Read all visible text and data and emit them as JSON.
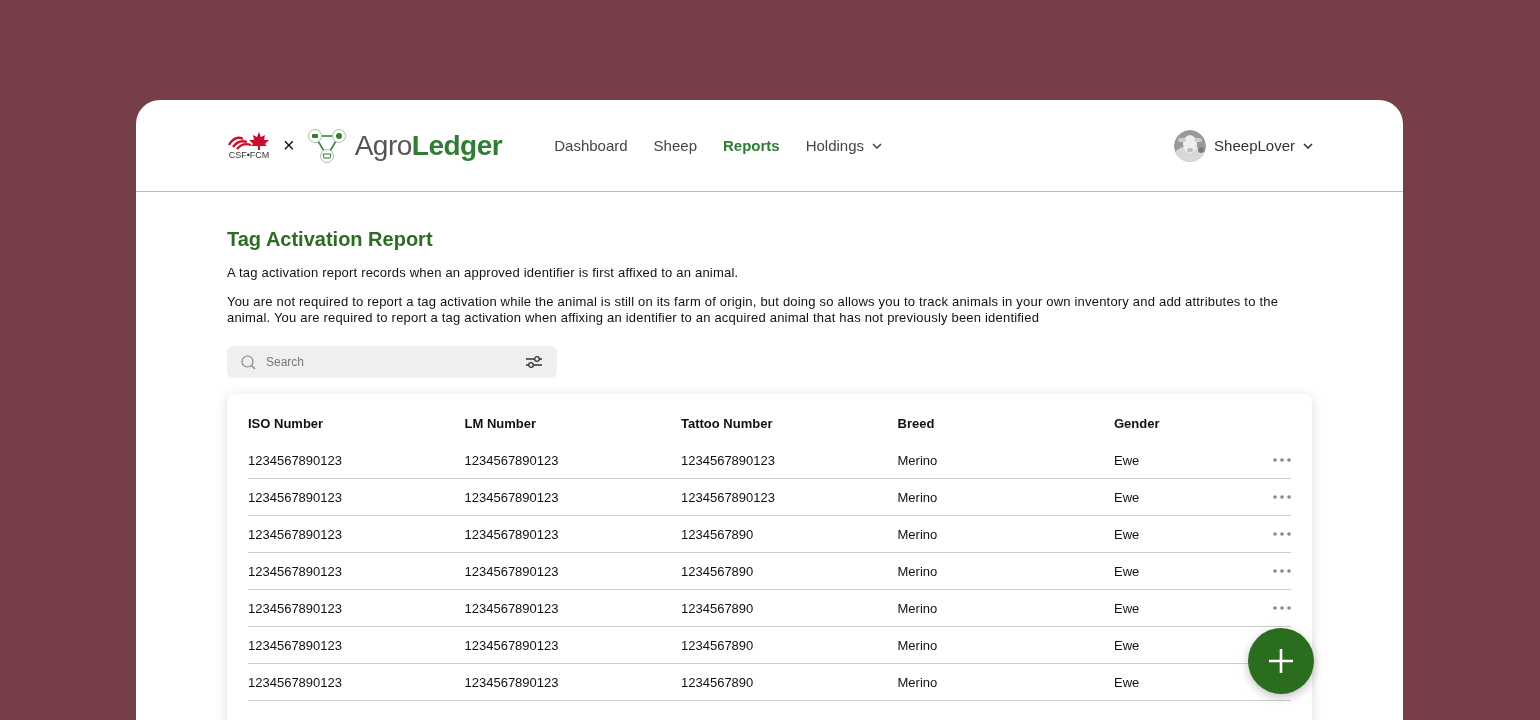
{
  "header": {
    "partner_logo": "CSF•FCM",
    "separator": "×",
    "brand": "Agro**Ledger**",
    "nav": [
      {
        "label": "Dashboard",
        "selected": false,
        "dropdown": false
      },
      {
        "label": "Sheep",
        "selected": false,
        "dropdown": false
      },
      {
        "label": "Reports",
        "selected": true,
        "dropdown": false
      },
      {
        "label": "Holdings",
        "selected": false,
        "dropdown": true
      }
    ],
    "user": {
      "name": "SheepLover"
    }
  },
  "page": {
    "title": "Tag Activation Report",
    "paragraphs": [
      "A tag activation report records when an approved identifier is first affixed to an animal.",
      "You are not required to report a tag activation while the animal is still on its farm of origin, but doing so allows you to track animals in your own inventory and add attributes to the animal. You are required to report a tag activation when affixing an identifier to an acquired animal that has not previously been identified"
    ]
  },
  "search": {
    "placeholder": "Search"
  },
  "table": {
    "columns": [
      "ISO Number",
      "LM Number",
      "Tattoo Number",
      "Breed",
      "Gender"
    ],
    "rows": [
      {
        "cells": [
          "1234567890123",
          "1234567890123",
          "1234567890123",
          "Merino",
          "Ewe"
        ],
        "menu": true
      },
      {
        "cells": [
          "1234567890123",
          "1234567890123",
          "1234567890123",
          "Merino",
          "Ewe"
        ],
        "menu": true
      },
      {
        "cells": [
          "1234567890123",
          "1234567890123",
          "1234567890",
          "Merino",
          "Ewe"
        ],
        "menu": true
      },
      {
        "cells": [
          "1234567890123",
          "1234567890123",
          "1234567890",
          "Merino",
          "Ewe"
        ],
        "menu": true
      },
      {
        "cells": [
          "1234567890123",
          "1234567890123",
          "1234567890",
          "Merino",
          "Ewe"
        ],
        "menu": true
      },
      {
        "cells": [
          "1234567890123",
          "1234567890123",
          "1234567890",
          "Merino",
          "Ewe"
        ]
      },
      {
        "cells": [
          "1234567890123",
          "1234567890123",
          "1234567890",
          "Merino",
          "Ewe"
        ]
      }
    ]
  },
  "fab": {
    "kind": "add"
  }
}
